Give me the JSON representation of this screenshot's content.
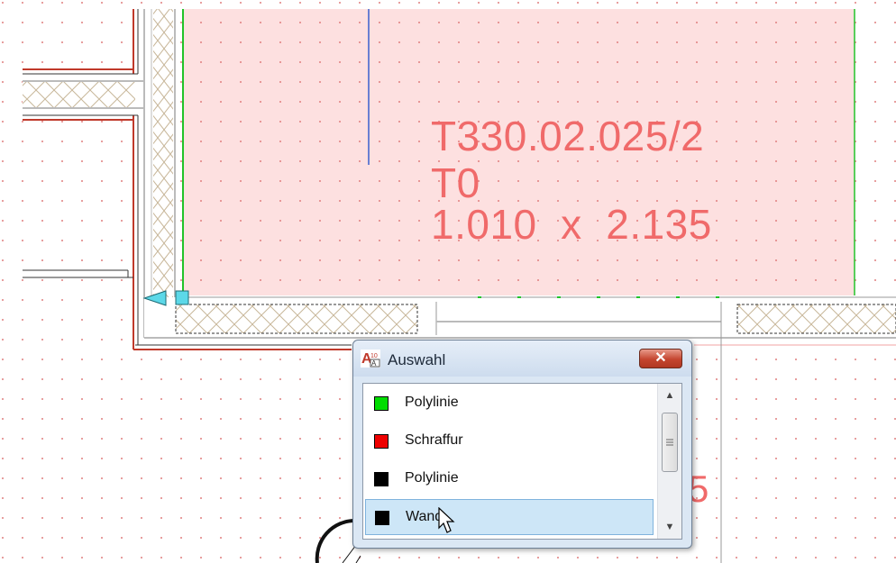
{
  "drawing": {
    "room_id": "T330.02.025/2",
    "room_type": "T0",
    "room_dimensions": "1.010  x  2.135",
    "partial_text": "5",
    "colors": {
      "room_fill": "#fde0e0",
      "room_text": "#f06a6a",
      "wall_outline": "#c0392b",
      "hatch": "#c8b79a",
      "polyline_green": "#22c32a"
    }
  },
  "dialog": {
    "title": "Auswahl",
    "app_icon": "a10-app-icon",
    "close_label": "✕",
    "items": [
      {
        "label": "Polylinie",
        "color": "#00dd00",
        "selected": false
      },
      {
        "label": "Schraffur",
        "color": "#ee0000",
        "selected": false
      },
      {
        "label": "Polylinie",
        "color": "#000000",
        "selected": false
      },
      {
        "label": "Wand",
        "color": "#000000",
        "selected": true
      }
    ],
    "scroll_up_glyph": "▲",
    "scroll_down_glyph": "▼"
  }
}
